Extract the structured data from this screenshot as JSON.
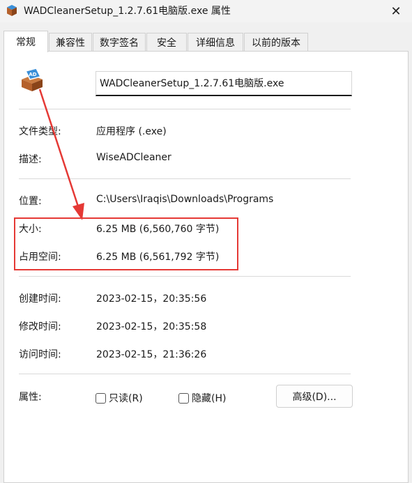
{
  "window": {
    "title": "WADCleanerSetup_1.2.7.61电脑版.exe 属性",
    "close_label": "✕"
  },
  "tabs": [
    {
      "label": "常规",
      "active": true
    },
    {
      "label": "兼容性"
    },
    {
      "label": "数字签名"
    },
    {
      "label": "安全"
    },
    {
      "label": "详细信息"
    },
    {
      "label": "以前的版本"
    }
  ],
  "file": {
    "name": "WADCleanerSetup_1.2.7.61电脑版.exe",
    "icon": "installer-box-icon"
  },
  "fields": {
    "type_label": "文件类型:",
    "type_value": "应用程序 (.exe)",
    "desc_label": "描述:",
    "desc_value": "WiseADCleaner",
    "location_label": "位置:",
    "location_value": "C:\\Users\\Iraqis\\Downloads\\Programs",
    "size_label": "大小:",
    "size_value": "6.25 MB (6,560,760 字节)",
    "disk_label": "占用空间:",
    "disk_value": "6.25 MB (6,561,792 字节)",
    "created_label": "创建时间:",
    "created_value": "2023-02-15，20:35:56",
    "modified_label": "修改时间:",
    "modified_value": "2023-02-15，20:35:58",
    "accessed_label": "访问时间:",
    "accessed_value": "2023-02-15，21:36:26"
  },
  "attributes": {
    "label": "属性:",
    "readonly_label": "只读(R)",
    "readonly_checked": false,
    "hidden_label": "隐藏(H)",
    "hidden_checked": false,
    "advanced_label": "高级(D)..."
  },
  "colors": {
    "annotation": "#e53935",
    "panel": "#ffffff",
    "background": "#f0f0f0"
  }
}
